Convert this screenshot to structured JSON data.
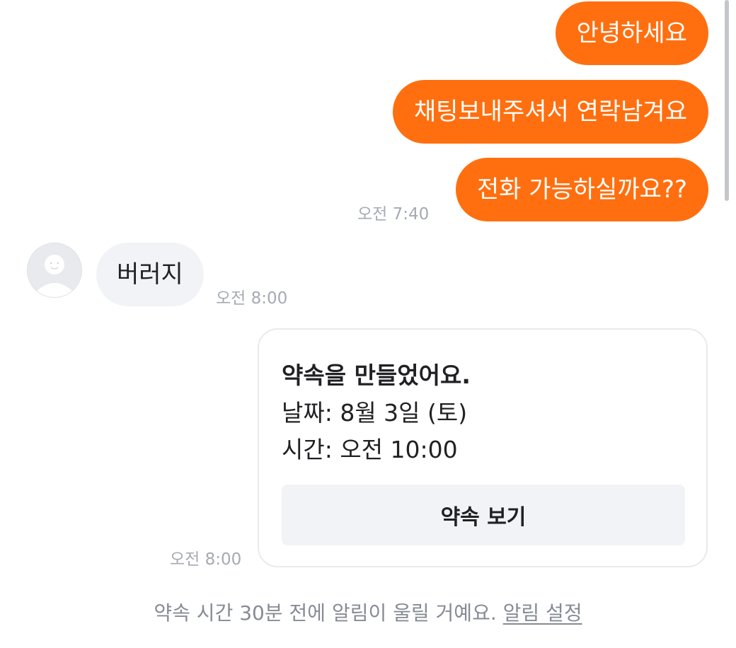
{
  "messages": {
    "outgoing_1": "안녕하세요",
    "outgoing_2": "채팅보내주셔서 연락남겨요",
    "outgoing_3": "전화 가능하실까요??",
    "outgoing_time": "오전 7:40",
    "incoming_1": "버러지",
    "incoming_time": "오전 8:00"
  },
  "appointment": {
    "title": "약속을 만들었어요.",
    "date_line": "날짜: 8월 3일 (토)",
    "time_line": "시간: 오전 10:00",
    "button_label": "약속 보기",
    "sent_time": "오전 8:00"
  },
  "notice": {
    "text": "약속 시간 30분 전에 알림이 울릴 거예요.",
    "link_label": "알림 설정"
  },
  "colors": {
    "accent": "#ff6f0f",
    "incoming_bubble": "#f2f3f6",
    "timestamp": "#a6aab2"
  },
  "icons": {
    "avatar": "default-profile-icon"
  }
}
